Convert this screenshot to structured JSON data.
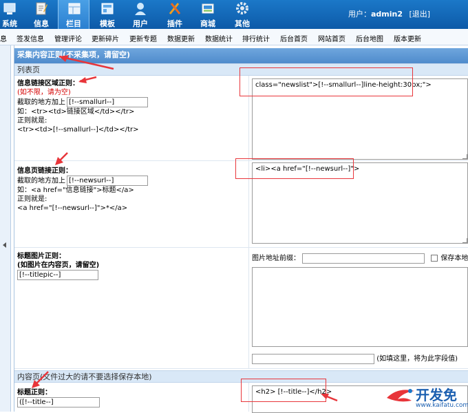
{
  "nav": {
    "items": [
      {
        "label": "系统",
        "icon": "system-icon"
      },
      {
        "label": "信息",
        "icon": "document-icon"
      },
      {
        "label": "栏目",
        "icon": "folder-icon",
        "active": true
      },
      {
        "label": "模板",
        "icon": "template-icon"
      },
      {
        "label": "用户",
        "icon": "user-icon"
      },
      {
        "label": "插件",
        "icon": "plugin-icon"
      },
      {
        "label": "商城",
        "icon": "shop-icon"
      },
      {
        "label": "其他",
        "icon": "gear-icon"
      }
    ],
    "user_prefix": "用户：",
    "username": "admin2",
    "logout": "[退出]"
  },
  "subnav": [
    "息",
    "签发信息",
    "管理评论",
    "更新碎片",
    "更新专题",
    "数据更新",
    "数据统计",
    "排行统计",
    "后台首页",
    "网站首页",
    "后台地图",
    "版本更新"
  ],
  "section": {
    "title": "采集内容正则(不采集项，请留空)",
    "list_page": "列表页",
    "content_page": "内容页(文件过大的请不要选择保存本地)"
  },
  "fields": {
    "link_area": {
      "title": "信息链接区域正则：",
      "note": "(如不限，请为空)",
      "capture_label": "截取的地方加上",
      "capture_value": "[!--smallurl--]",
      "example": "如：<tr><td>链接区域</td></tr>",
      "regex_label": "正则就是:",
      "regex": "<tr><td>[!--smallurl--]</td></tr>",
      "textarea": "class=\"newslist\">[!--smallurl--]line-height:30px;\">"
    },
    "page_link": {
      "title": "信息页链接正则：",
      "capture_label": "截取的地方加上",
      "capture_value": "[!--newsurl--]",
      "example": "如：<a href=\"信息链接\">标题</a>",
      "regex_label": "正则就是:",
      "regex": "<a href=\"[!--newsurl--]\">*</a>",
      "textarea": "<li><a href=\"[!--newsurl--]\">"
    },
    "title_pic": {
      "title": "标题图片正则：",
      "note": "(如图片在内容页，请留空)",
      "value": "[!--titlepic--]",
      "prefix_label": "图片地址前缀：",
      "save_local": "保存本地",
      "hint": "(如填这里，将为此字段值)"
    },
    "title": {
      "title": "标题正则：",
      "value": "([!--title--]",
      "textarea": "<h2> [!--title--]</h2>"
    }
  },
  "watermark": {
    "text": "开发免",
    "url": "www.kaifatu.com"
  }
}
